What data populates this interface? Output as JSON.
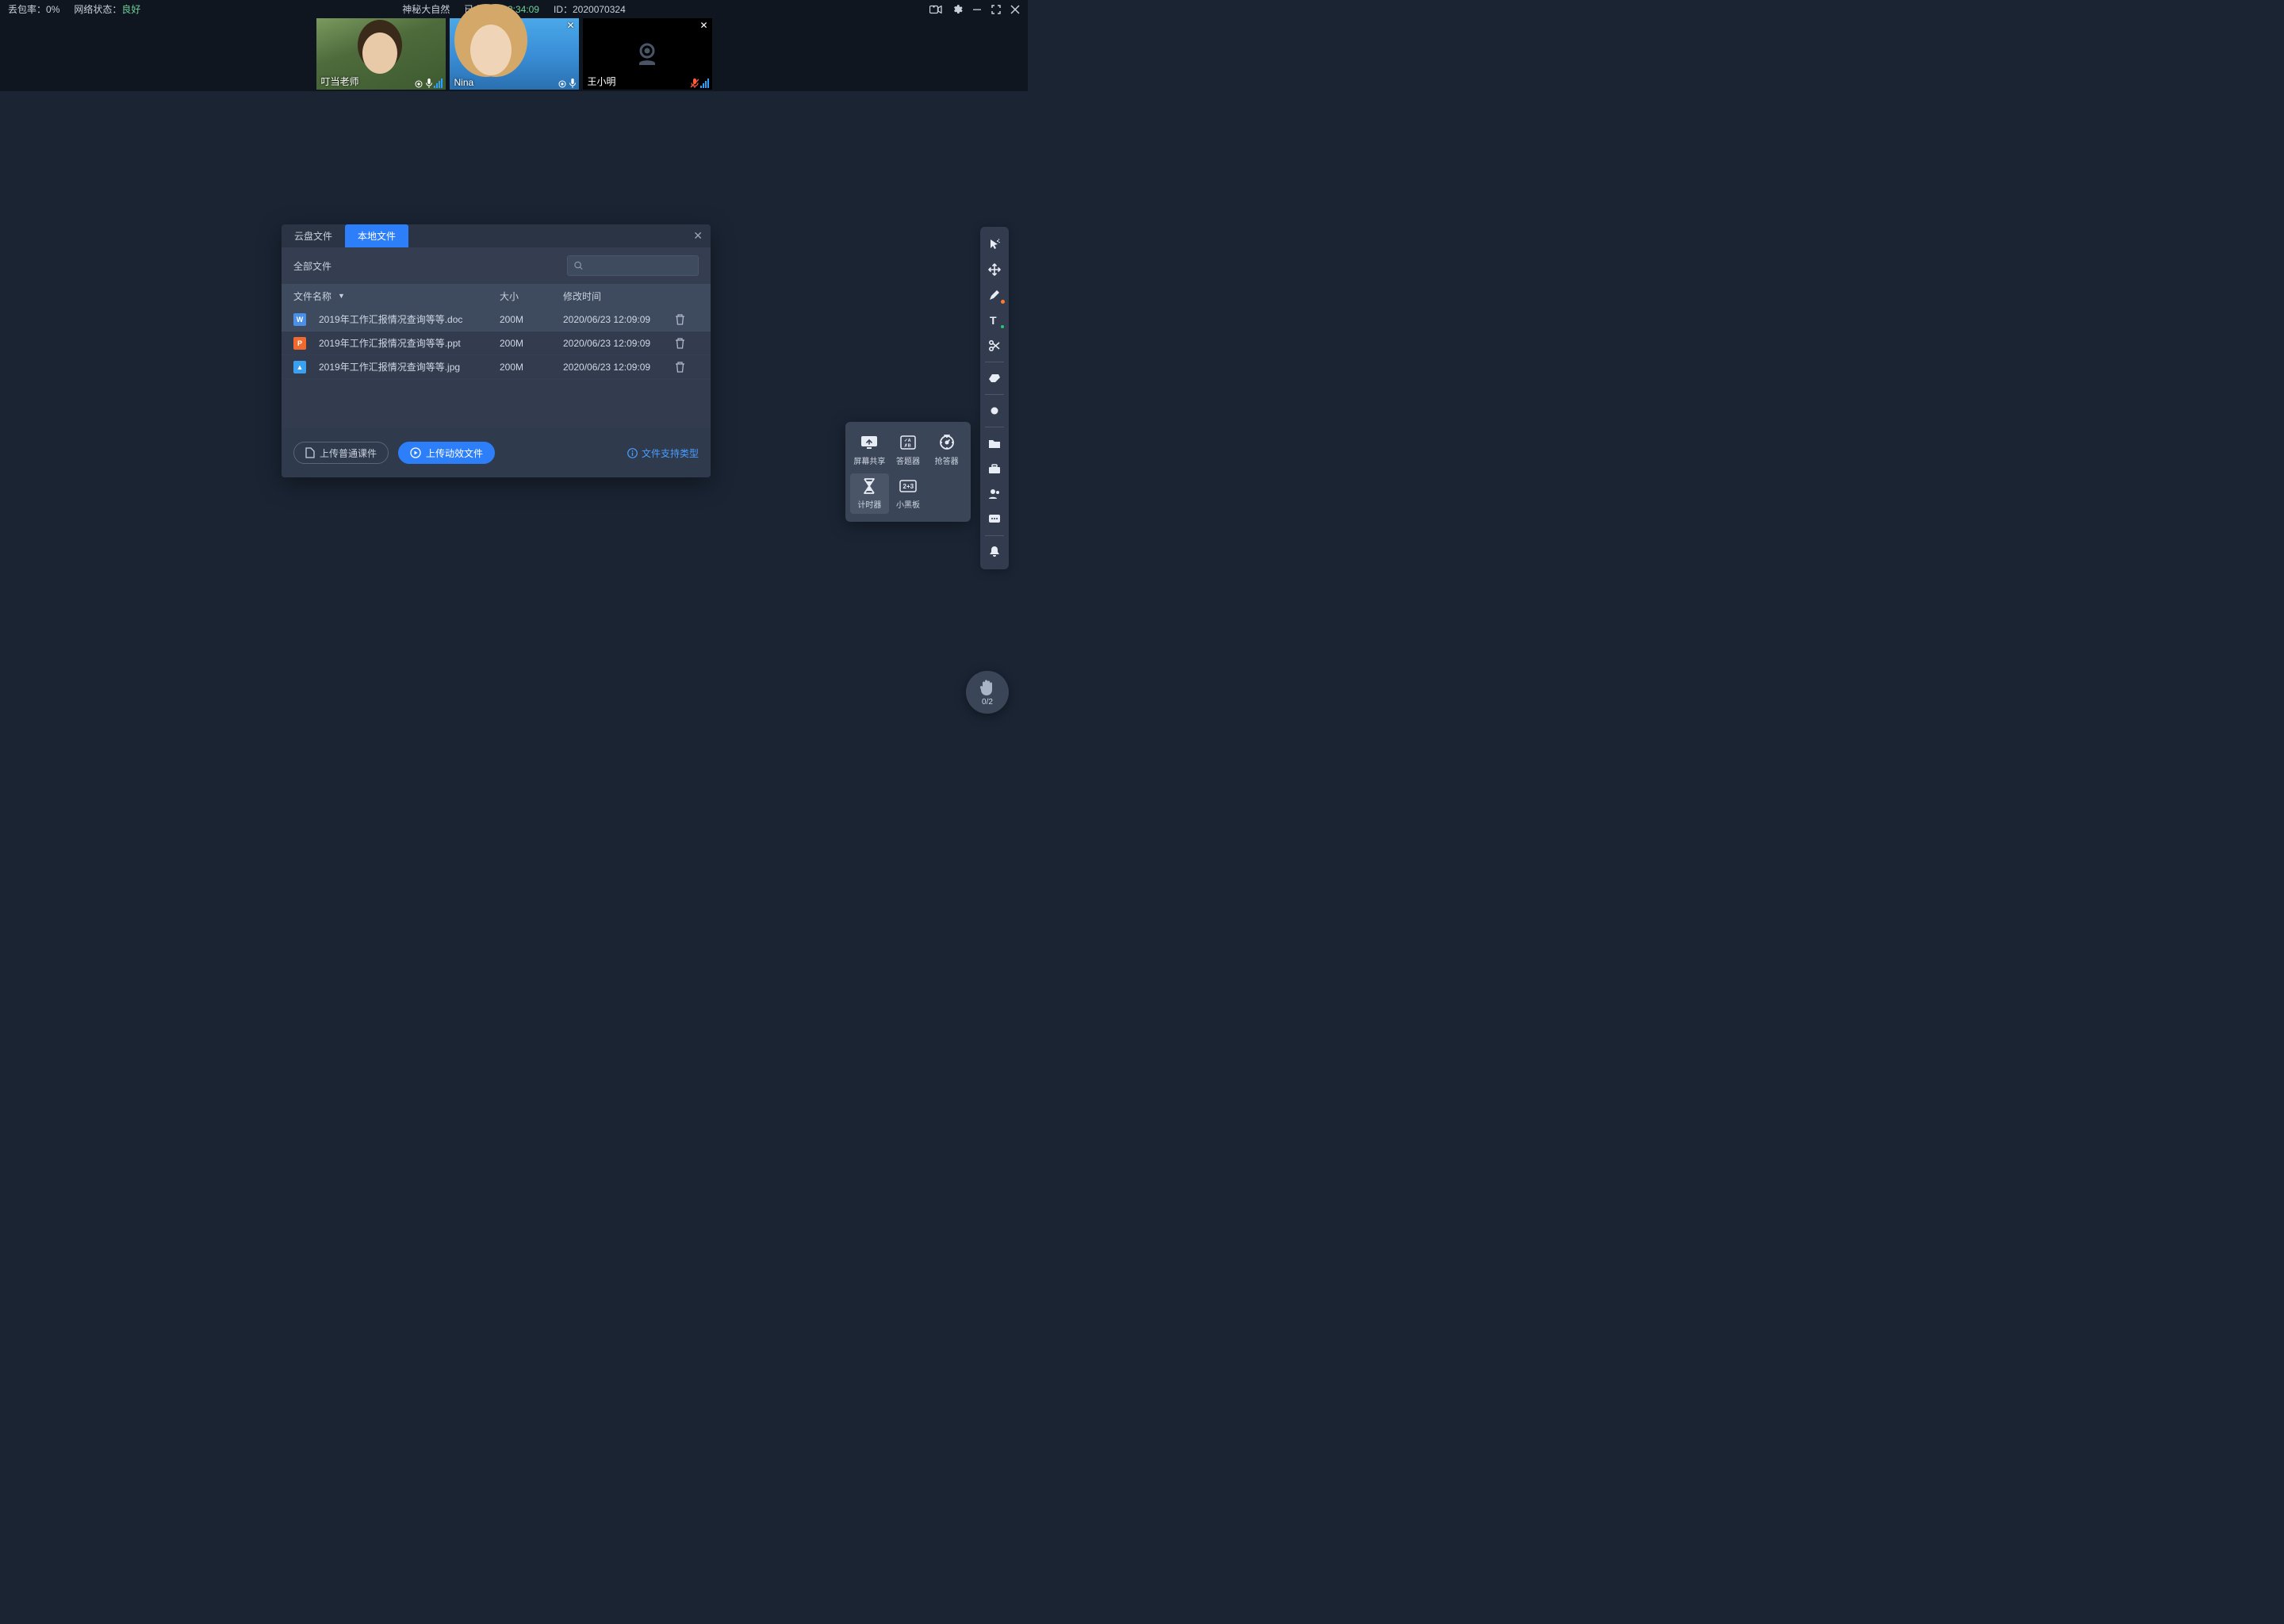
{
  "topBar": {
    "packetLossLabel": "丢包率：",
    "packetLossValue": "0%",
    "networkLabel": "网络状态：",
    "networkValue": "良好",
    "title": "神秘大自然",
    "elapsedLabel": "已上课：",
    "elapsedValue": "02:34:09",
    "idLabel": "ID：",
    "idValue": "2020070324"
  },
  "videos": [
    {
      "name": "叮当老师",
      "cameraOn": true,
      "closeable": false
    },
    {
      "name": "Nina",
      "cameraOn": true,
      "closeable": true
    },
    {
      "name": "王小明",
      "cameraOn": false,
      "closeable": true,
      "micMuted": true
    }
  ],
  "dialog": {
    "tabs": {
      "cloud": "云盘文件",
      "local": "本地文件"
    },
    "filterLabel": "全部文件",
    "columns": {
      "name": "文件名称",
      "size": "大小",
      "time": "修改时间"
    },
    "rows": [
      {
        "icon": "W",
        "cls": "fi-doc",
        "name": "2019年工作汇报情况查询等等.doc",
        "size": "200M",
        "time": "2020/06/23 12:09:09"
      },
      {
        "icon": "P",
        "cls": "fi-ppt",
        "name": "2019年工作汇报情况查询等等.ppt",
        "size": "200M",
        "time": "2020/06/23 12:09:09"
      },
      {
        "icon": "▲",
        "cls": "fi-img",
        "name": "2019年工作汇报情况查询等等.jpg",
        "size": "200M",
        "time": "2020/06/23 12:09:09"
      }
    ],
    "uploadNormal": "上传普通课件",
    "uploadAnimated": "上传动效文件",
    "supportedTypes": "文件支持类型"
  },
  "toolsPopover": {
    "screenShare": "屏幕共享",
    "responder": "答题器",
    "buzzer": "抢答器",
    "timer": "计时器",
    "blackboard": "小黑板"
  },
  "raiseHand": {
    "count": "0/2"
  }
}
